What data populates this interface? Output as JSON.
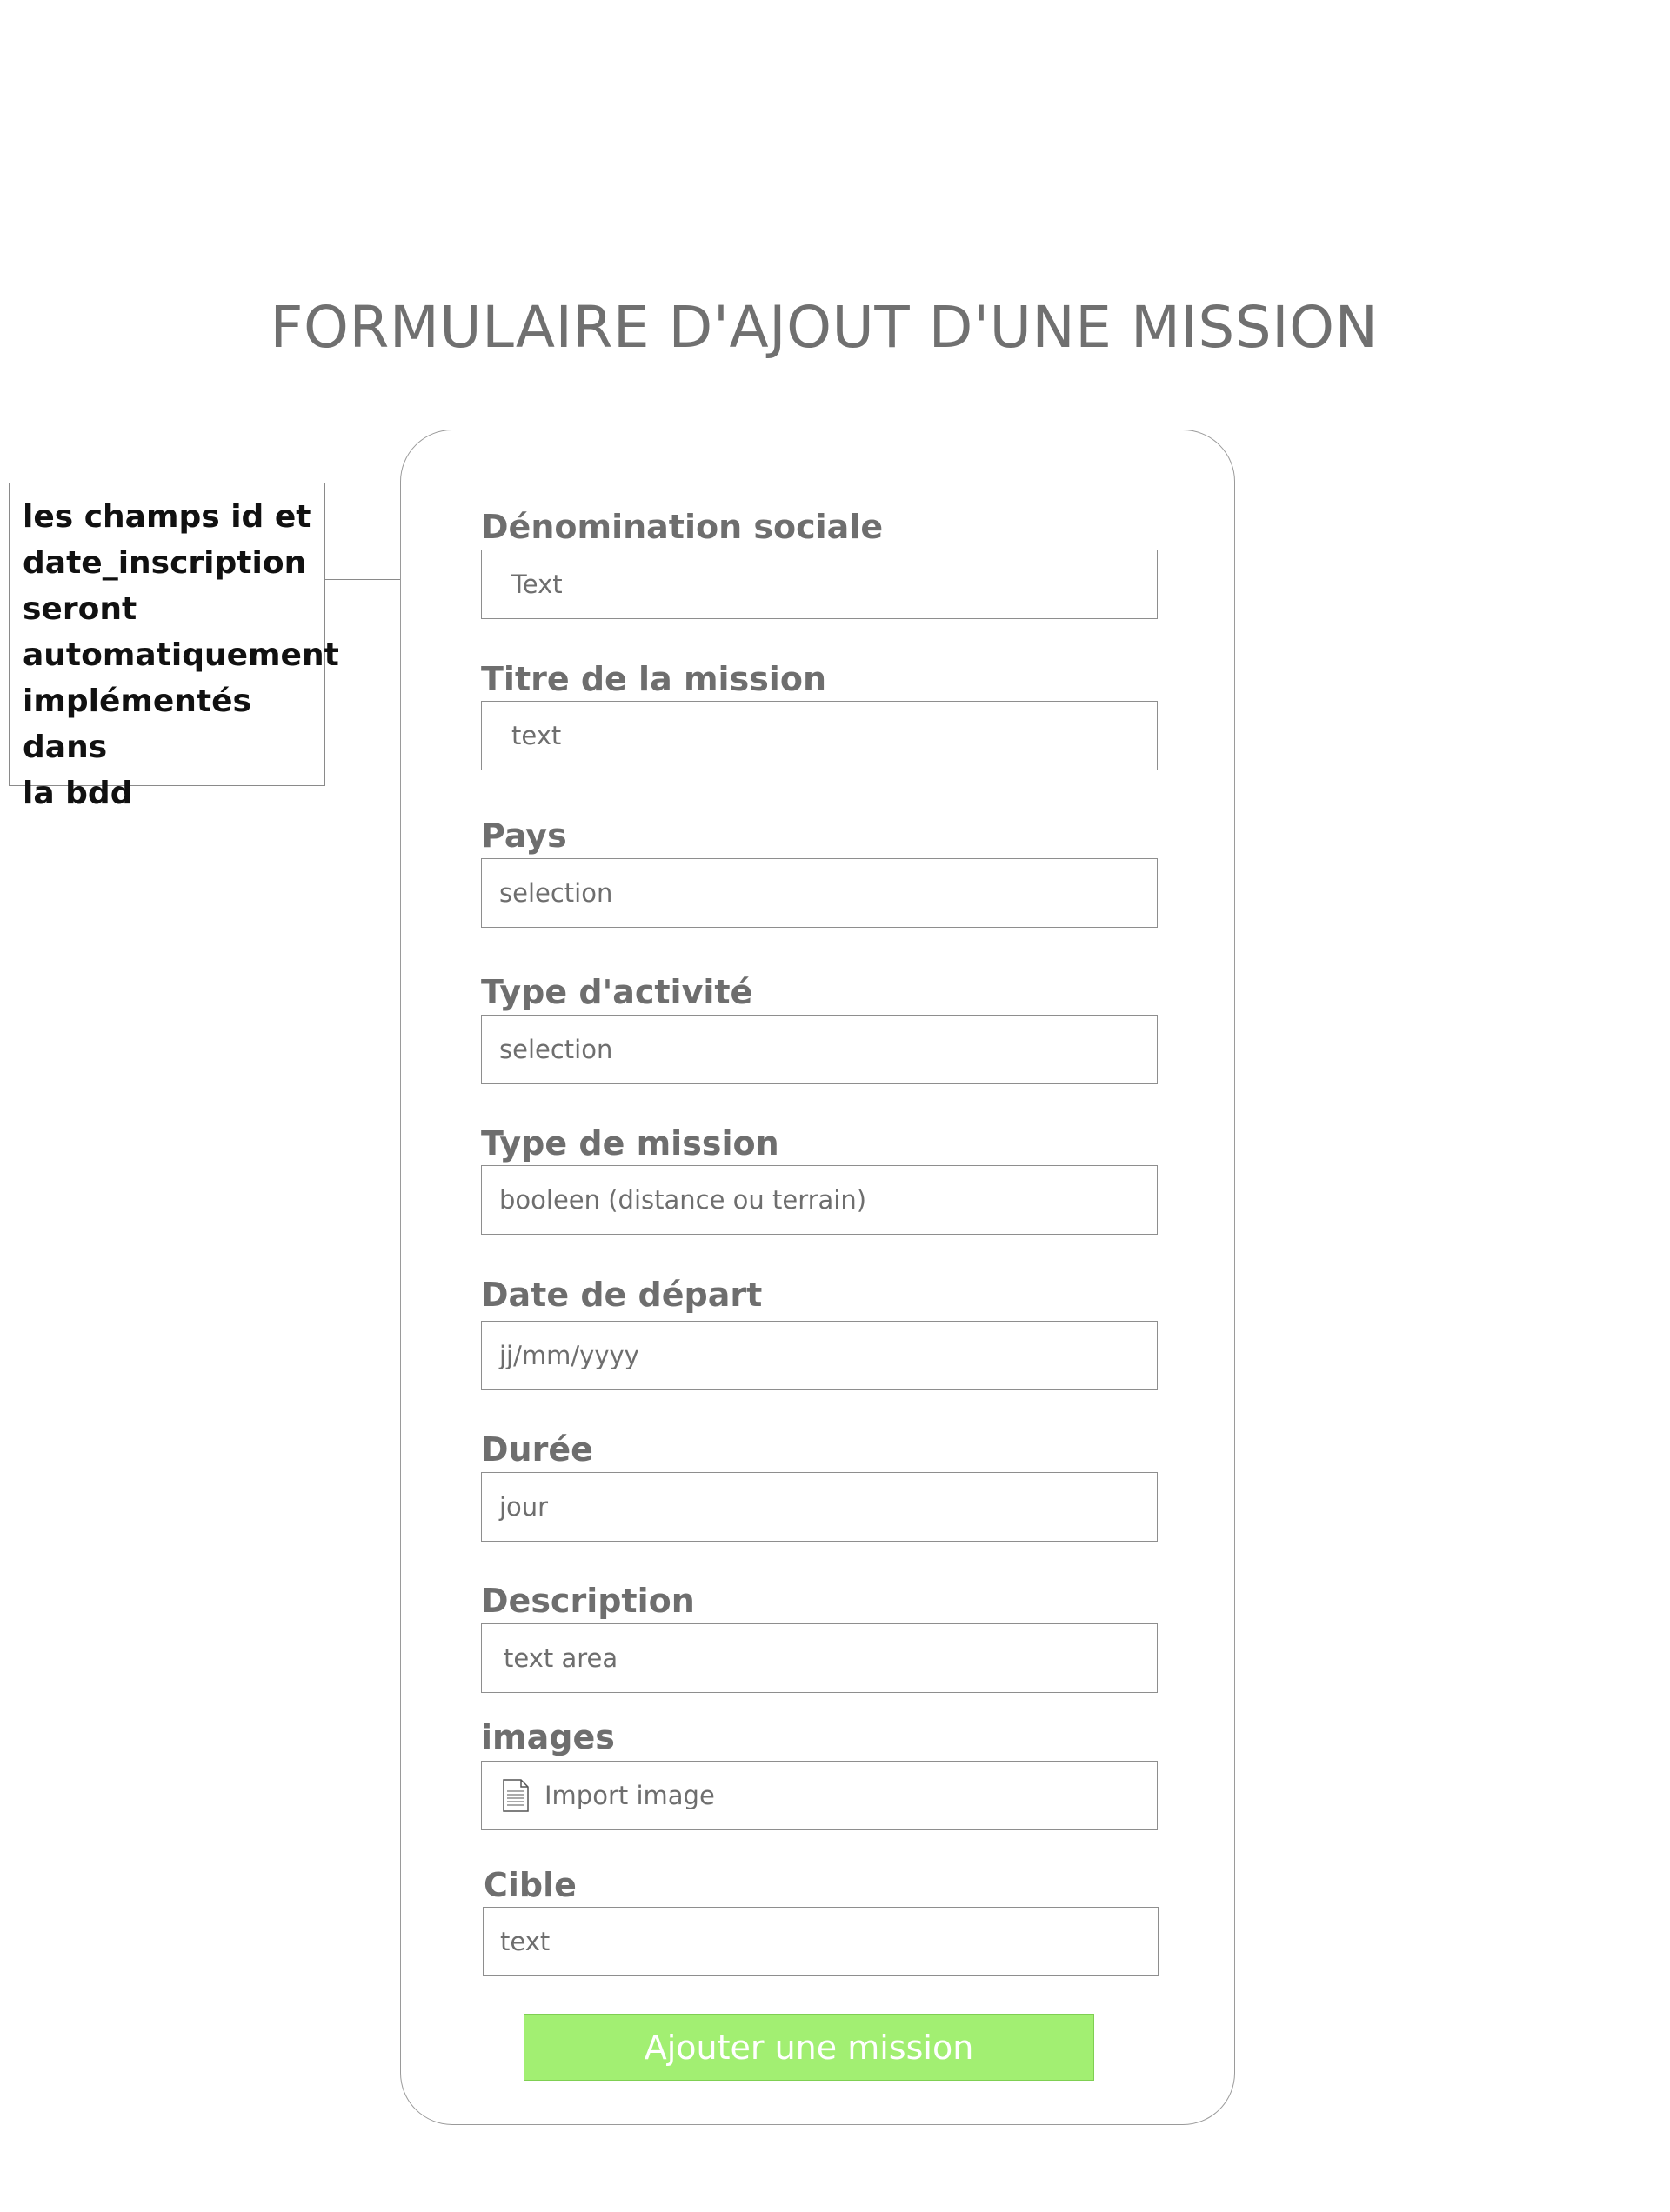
{
  "page": {
    "title": "FORMULAIRE D'AJOUT D'UNE MISSION"
  },
  "note": {
    "lines": [
      "les champs id et",
      "date_inscription",
      "seront",
      "automatiquement",
      "implémentés dans",
      "la bdd"
    ]
  },
  "form": {
    "fields": [
      {
        "label": "Dénomination sociale",
        "placeholder": "Text"
      },
      {
        "label": "Titre de la mission",
        "placeholder": "text"
      },
      {
        "label": "Pays",
        "placeholder": "selection"
      },
      {
        "label": "Type d'activité",
        "placeholder": "selection"
      },
      {
        "label": "Type de mission",
        "placeholder": "booleen (distance ou terrain)"
      },
      {
        "label": "Date de départ",
        "placeholder": "jj/mm/yyyy"
      },
      {
        "label": "Durée",
        "placeholder": "jour"
      },
      {
        "label": "Description",
        "placeholder": "text area"
      },
      {
        "label": "images",
        "placeholder": "Import image",
        "icon": "file-icon"
      },
      {
        "label": "Cible",
        "placeholder": "text"
      }
    ],
    "submit_label": "Ajouter une mission"
  },
  "colors": {
    "label_text": "#6e6e6e",
    "submit_bg": "#a2ef72",
    "submit_text": "#ffffff",
    "border": "#8e8e8e"
  }
}
